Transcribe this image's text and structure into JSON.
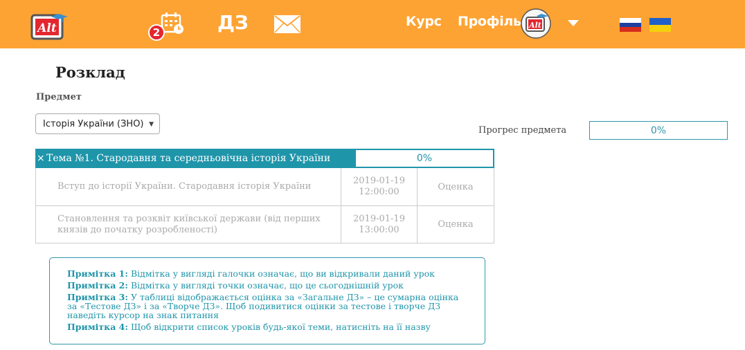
{
  "header": {
    "logo_text": "Alt",
    "notification_count": "2",
    "homework_label": "ДЗ",
    "nav_course": "Курс",
    "nav_profile": "Профіль",
    "avatar_text": "Alt",
    "icons": {
      "calendar": "calendar-clock-icon",
      "mail": "envelope-icon",
      "dropdown": "caret-down-icon"
    },
    "colors": {
      "bar": "#fda333"
    }
  },
  "page": {
    "title": "Розклад",
    "subject_label": "Предмет",
    "subject_selected": "Історія України (ЗНО)",
    "progress_label": "Прогрес предмета",
    "progress_value": "0%"
  },
  "topic": {
    "close_symbol": "×",
    "title": "Тема №1. Стародавня та середньовічна історія України",
    "progress": "0%",
    "lessons": [
      {
        "name": "Вступ до історії України. Стародавня історія України",
        "date": "2019-01-19",
        "time": "12:00:00",
        "grade": "Оценка"
      },
      {
        "name": "Становлення та розквіт київської держави (від перших князів до початку розробленості)",
        "date": "2019-01-19",
        "time": "13:00:00",
        "grade": "Оценка"
      }
    ]
  },
  "notes": [
    {
      "label": "Примітка 1:",
      "text": " Відмітка у вигляді галочки означає, що ви відкривали даний урок"
    },
    {
      "label": "Примітка 2:",
      "text": " Відмітка у вигляді точки означає, що це сьогоднішній урок"
    },
    {
      "label": "Примітка 3:",
      "text": " У таблиці відображається оцінка за «Загальне ДЗ» – це сумарна оцінка за «Тестове ДЗ» і за «Творче ДЗ». Щоб подивитися оцінки за тестове і творче ДЗ наведіть курсор на знак питання"
    },
    {
      "label": "Примітка 4:",
      "text": " Щоб відкрити список уроків будь-якої теми, натисніть на її назву"
    }
  ]
}
